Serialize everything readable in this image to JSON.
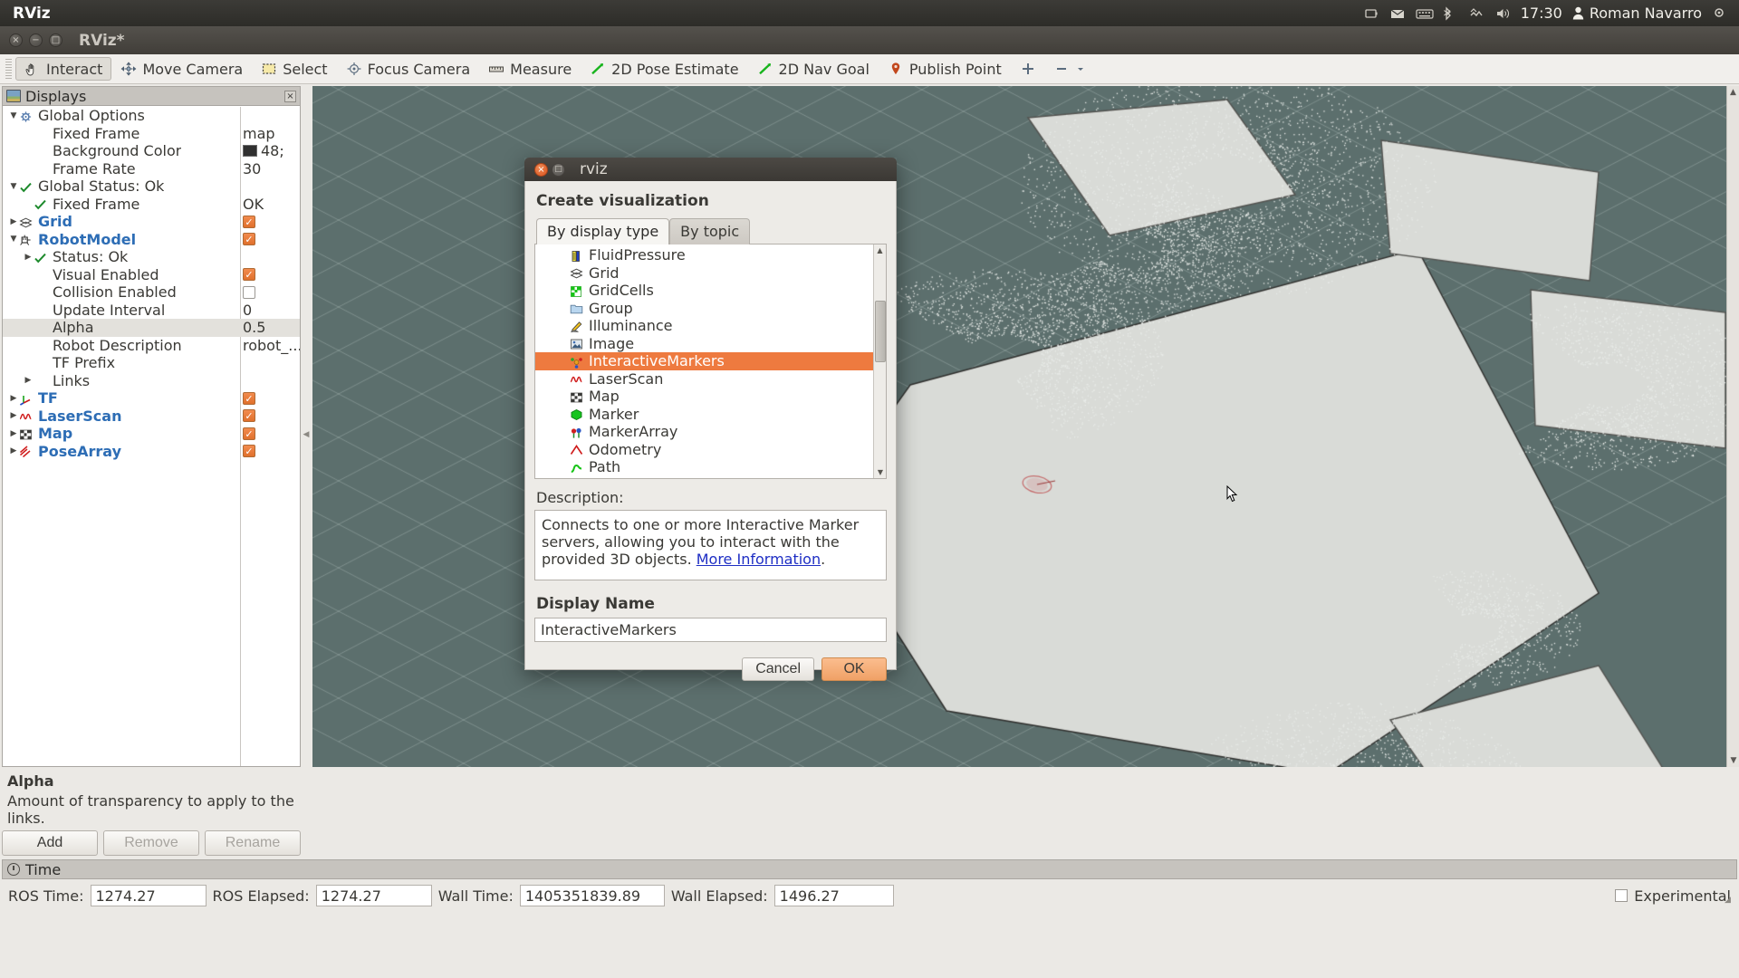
{
  "unity_panel": {
    "title": "RViz",
    "clock": "17:30",
    "user": "Roman Navarro",
    "tray_icons": [
      "battery-icon",
      "mail-icon",
      "keyboard-icon",
      "bluetooth-icon",
      "network-icon",
      "volume-icon"
    ]
  },
  "window": {
    "title": "RViz*",
    "buttons": [
      "close-icon",
      "minimize-icon",
      "maximize-icon"
    ]
  },
  "toolbar": {
    "items": [
      {
        "label": "Interact",
        "icon": "hand-cursor-icon",
        "active": true
      },
      {
        "label": "Move Camera",
        "icon": "move-camera-icon",
        "active": false
      },
      {
        "label": "Select",
        "icon": "select-rect-icon",
        "active": false
      },
      {
        "label": "Focus Camera",
        "icon": "focus-camera-icon",
        "active": false
      },
      {
        "label": "Measure",
        "icon": "measure-ruler-icon",
        "active": false
      },
      {
        "label": "2D Pose Estimate",
        "icon": "pose-arrow-icon",
        "active": false
      },
      {
        "label": "2D Nav Goal",
        "icon": "nav-goal-arrow-icon",
        "active": false
      },
      {
        "label": "Publish Point",
        "icon": "map-pin-icon",
        "active": false
      },
      {
        "label": "",
        "icon": "add-tool-icon",
        "active": false
      },
      {
        "label": "",
        "icon": "remove-tool-icon",
        "active": false
      }
    ]
  },
  "displays_panel": {
    "header": "Displays",
    "close_label": "×",
    "rows": [
      {
        "indent": 0,
        "arrow": "▼",
        "icon": "gear-icon",
        "label": "Global Options",
        "bold": false,
        "value": "",
        "value_type": "none",
        "selected": false
      },
      {
        "indent": 1,
        "arrow": "",
        "icon": "",
        "label": "Fixed Frame",
        "bold": false,
        "value": "map",
        "value_type": "text",
        "selected": false
      },
      {
        "indent": 1,
        "arrow": "",
        "icon": "",
        "label": "Background Color",
        "bold": false,
        "value": "48;",
        "value_type": "color",
        "color": "#303030",
        "selected": false
      },
      {
        "indent": 1,
        "arrow": "",
        "icon": "",
        "label": "Frame Rate",
        "bold": false,
        "value": "30",
        "value_type": "text",
        "selected": false
      },
      {
        "indent": 0,
        "arrow": "▼",
        "icon": "check-icon",
        "label": "Global Status: Ok",
        "bold": false,
        "value": "",
        "value_type": "none",
        "selected": false
      },
      {
        "indent": 1,
        "arrow": "",
        "icon": "check-icon",
        "label": "Fixed Frame",
        "bold": false,
        "value": "OK",
        "value_type": "text",
        "selected": false
      },
      {
        "indent": 0,
        "arrow": "▶",
        "icon": "grid-icon",
        "label": "Grid",
        "bold": true,
        "value": "checked",
        "value_type": "checkbox",
        "checked": true,
        "selected": false
      },
      {
        "indent": 0,
        "arrow": "▼",
        "icon": "robot-icon",
        "label": "RobotModel",
        "bold": true,
        "value": "checked",
        "value_type": "checkbox",
        "checked": true,
        "selected": false
      },
      {
        "indent": 1,
        "arrow": "▶",
        "icon": "check-icon",
        "label": "Status: Ok",
        "bold": false,
        "value": "",
        "value_type": "none",
        "selected": false
      },
      {
        "indent": 1,
        "arrow": "",
        "icon": "",
        "label": "Visual Enabled",
        "bold": false,
        "value": "checked",
        "value_type": "checkbox",
        "checked": true,
        "selected": false
      },
      {
        "indent": 1,
        "arrow": "",
        "icon": "",
        "label": "Collision Enabled",
        "bold": false,
        "value": "unchecked",
        "value_type": "checkbox",
        "checked": false,
        "selected": false
      },
      {
        "indent": 1,
        "arrow": "",
        "icon": "",
        "label": "Update Interval",
        "bold": false,
        "value": "0",
        "value_type": "text",
        "selected": false
      },
      {
        "indent": 1,
        "arrow": "",
        "icon": "",
        "label": "Alpha",
        "bold": false,
        "value": "0.5",
        "value_type": "text",
        "selected": true
      },
      {
        "indent": 1,
        "arrow": "",
        "icon": "",
        "label": "Robot Description",
        "bold": false,
        "value": "robot_...",
        "value_type": "text",
        "selected": false
      },
      {
        "indent": 1,
        "arrow": "",
        "icon": "",
        "label": "TF Prefix",
        "bold": false,
        "value": "",
        "value_type": "none",
        "selected": false
      },
      {
        "indent": 1,
        "arrow": "▶",
        "icon": "",
        "label": "Links",
        "bold": false,
        "value": "",
        "value_type": "none",
        "selected": false
      },
      {
        "indent": 0,
        "arrow": "▶",
        "icon": "tf-axes-icon",
        "label": "TF",
        "bold": true,
        "value": "checked",
        "value_type": "checkbox",
        "checked": true,
        "selected": false
      },
      {
        "indent": 0,
        "arrow": "▶",
        "icon": "laserscan-icon",
        "label": "LaserScan",
        "bold": true,
        "value": "checked",
        "value_type": "checkbox",
        "checked": true,
        "selected": false
      },
      {
        "indent": 0,
        "arrow": "▶",
        "icon": "map-grid-icon",
        "label": "Map",
        "bold": true,
        "value": "checked",
        "value_type": "checkbox",
        "checked": true,
        "selected": false
      },
      {
        "indent": 0,
        "arrow": "▶",
        "icon": "posearray-icon",
        "label": "PoseArray",
        "bold": true,
        "value": "checked",
        "value_type": "checkbox",
        "checked": true,
        "selected": false
      }
    ]
  },
  "help": {
    "title": "Alpha",
    "text": "Amount of transparency to apply to the links."
  },
  "panel_buttons": {
    "add": "Add",
    "remove": "Remove",
    "rename": "Rename"
  },
  "dialog": {
    "window_title": "rviz",
    "heading": "Create visualization",
    "tabs": [
      {
        "label": "By display type",
        "active": true
      },
      {
        "label": "By topic",
        "active": false
      }
    ],
    "display_types": [
      {
        "label": "FluidPressure",
        "icon": "fluidpressure-icon",
        "selected": false
      },
      {
        "label": "Grid",
        "icon": "grid-icon",
        "selected": false
      },
      {
        "label": "GridCells",
        "icon": "gridcells-icon",
        "selected": false
      },
      {
        "label": "Group",
        "icon": "folder-icon",
        "selected": false
      },
      {
        "label": "Illuminance",
        "icon": "illuminance-icon",
        "selected": false
      },
      {
        "label": "Image",
        "icon": "image-icon",
        "selected": false
      },
      {
        "label": "InteractiveMarkers",
        "icon": "interactivemarkers-icon",
        "selected": true
      },
      {
        "label": "LaserScan",
        "icon": "laserscan-icon",
        "selected": false
      },
      {
        "label": "Map",
        "icon": "map-grid-icon",
        "selected": false
      },
      {
        "label": "Marker",
        "icon": "marker-cube-icon",
        "selected": false
      },
      {
        "label": "MarkerArray",
        "icon": "markerarray-icon",
        "selected": false
      },
      {
        "label": "Odometry",
        "icon": "odometry-icon",
        "selected": false
      },
      {
        "label": "Path",
        "icon": "path-icon",
        "selected": false
      }
    ],
    "description_label": "Description:",
    "description_text_1": "Connects to one or more Interactive Marker servers,",
    "description_text_2": "allowing you to interact with the provided 3D",
    "description_text_3": "objects. ",
    "description_link": "More Information",
    "description_text_4": ".",
    "display_name_label": "Display Name",
    "display_name_value": "InteractiveMarkers",
    "cancel_label": "Cancel",
    "ok_label": "OK",
    "accent_color": "#ee7a3f"
  },
  "time_bar": {
    "title": "Time",
    "fields": [
      {
        "label": "ROS Time:",
        "value": "1274.27"
      },
      {
        "label": "ROS Elapsed:",
        "value": "1274.27"
      },
      {
        "label": "Wall Time:",
        "value": "1405351839.89"
      },
      {
        "label": "Wall Elapsed:",
        "value": "1496.27"
      }
    ],
    "experimental_label": "Experimental",
    "experimental_checked": false
  }
}
